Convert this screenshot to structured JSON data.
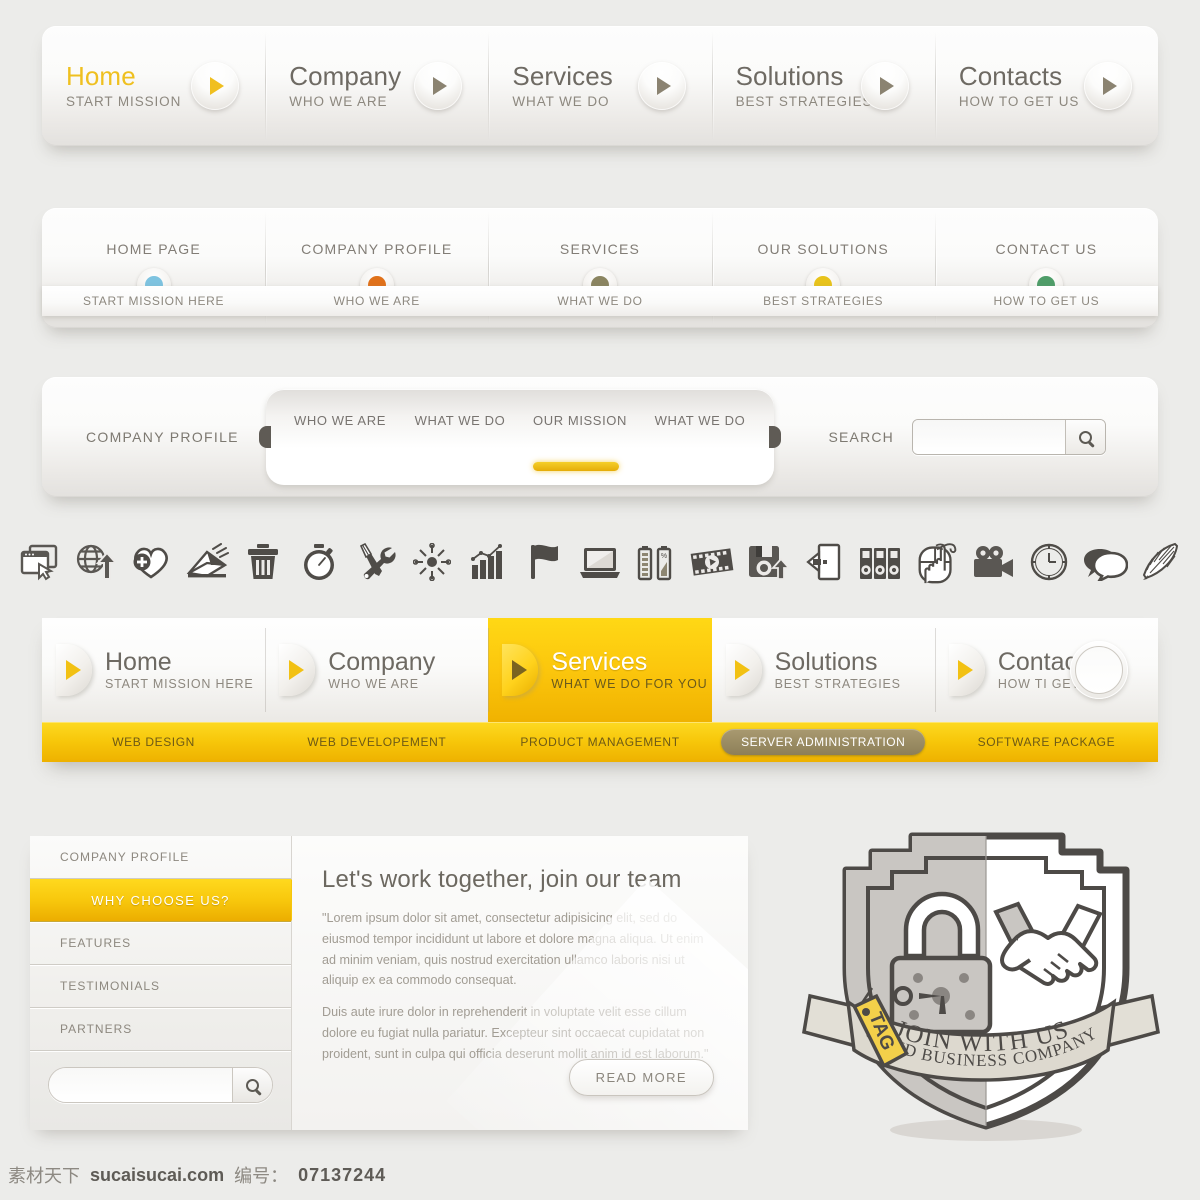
{
  "nav_primary": {
    "items": [
      {
        "title": "Home",
        "sub": "START MISSION",
        "active": true
      },
      {
        "title": "Company",
        "sub": "WHO WE ARE",
        "active": false
      },
      {
        "title": "Services",
        "sub": "WHAT WE DO",
        "active": false
      },
      {
        "title": "Solutions",
        "sub": "BEST STRATEGIES",
        "active": false
      },
      {
        "title": "Contacts",
        "sub": "HOW TO GET US",
        "active": false
      }
    ]
  },
  "nav_secondary": {
    "items": [
      {
        "title": "HOME PAGE",
        "sub": "START MISSION HERE",
        "dot": "#7ec3e0"
      },
      {
        "title": "COMPANY PROFILE",
        "sub": "WHO WE ARE",
        "dot": "#e0711a"
      },
      {
        "title": "SERVICES",
        "sub": "WHAT WE DO",
        "dot": "#8b8561"
      },
      {
        "title": "OUR SOLUTIONS",
        "sub": "BEST STRATEGIES",
        "dot": "#e8c31c"
      },
      {
        "title": "CONTACT US",
        "sub": "HOW TO GET US",
        "dot": "#4f9d69"
      }
    ]
  },
  "nav_tertiary": {
    "label": "COMPANY PROFILE",
    "tabs": [
      {
        "label": "WHO WE ARE",
        "active": false
      },
      {
        "label": "WHAT WE DO",
        "active": false
      },
      {
        "label": "OUR MISSION",
        "active": true
      },
      {
        "label": "WHAT WE DO",
        "active": false
      }
    ],
    "search_label": "SEARCH",
    "search_value": "",
    "search_placeholder": ""
  },
  "icon_row": {
    "icons": [
      "browser-window-icon",
      "globe-upload-icon",
      "heart-plus-icon",
      "mail-send-icon",
      "trash-icon",
      "stopwatch-icon",
      "tools-icon",
      "compass-icon",
      "bar-chart-icon",
      "flag-icon",
      "laptop-icon",
      "battery-icon",
      "film-play-icon",
      "floppy-upload-icon",
      "exit-door-icon",
      "binders-icon",
      "mouse-click-icon",
      "video-camera-icon",
      "clock-icon",
      "speech-bubbles-icon",
      "feather-quill-icon"
    ]
  },
  "nav_yellow": {
    "items": [
      {
        "title": "Home",
        "sub": "START MISSION HERE",
        "active": false
      },
      {
        "title": "Company",
        "sub": "WHO WE ARE",
        "active": false
      },
      {
        "title": "Services",
        "sub": "WHAT WE DO FOR YOU",
        "active": true
      },
      {
        "title": "Solutions",
        "sub": "BEST STRATEGIES",
        "active": false
      },
      {
        "title": "Contact us",
        "sub": "HOW TI GET US",
        "active": false
      }
    ],
    "sublinks": [
      {
        "label": "WEB DESIGN",
        "active": false
      },
      {
        "label": "WEB DEVELOPEMENT",
        "active": false
      },
      {
        "label": "PRODUCT MANAGEMENT",
        "active": false
      },
      {
        "label": "SERVER ADMINISTRATION",
        "active": true
      },
      {
        "label": "SOFTWARE PACKAGE",
        "active": false
      }
    ]
  },
  "content_panel": {
    "sidebar": [
      {
        "label": "COMPANY PROFILE",
        "active": false
      },
      {
        "label": "WHY CHOOSE US?",
        "active": true
      },
      {
        "label": "FEATURES",
        "active": false
      },
      {
        "label": "TESTIMONIALS",
        "active": false
      },
      {
        "label": "PARTNERS",
        "active": false
      }
    ],
    "search_value": "",
    "search_placeholder": "",
    "heading": "Let's work together, join our team",
    "paragraph1": "\"Lorem ipsum dolor sit amet, consectetur adipisicing elit, sed do eiusmod tempor incididunt ut labore et dolore magna aliqua. Ut enim ad minim veniam, quis nostrud exercitation ullamco laboris nisi ut aliquip ex ea commodo consequat.",
    "paragraph2": "Duis aute irure dolor in reprehenderit in voluptate velit esse cillum dolore eu fugiat nulla pariatur. Excepteur sint occaecat cupidatat non proident, sunt in culpa qui officia deserunt mollit anim id est laborum.\"",
    "read_more": "READ MORE"
  },
  "badge": {
    "tag_label": "TAG",
    "ribbon_line1": "JOIN WITH US",
    "ribbon_line2": "SOLID BUSINESS COMPANY"
  },
  "footer": {
    "site_cn": "素材天下",
    "domain": "sucaisucai.com",
    "id_label": "编号：",
    "id_value": "07137244"
  },
  "colors": {
    "accent_yellow": "#f5c60c",
    "accent_yellow_dark": "#eeb100",
    "text_gray": "#6e6a63",
    "text_muted": "#8d887f",
    "panel_bg": "#ececea"
  }
}
